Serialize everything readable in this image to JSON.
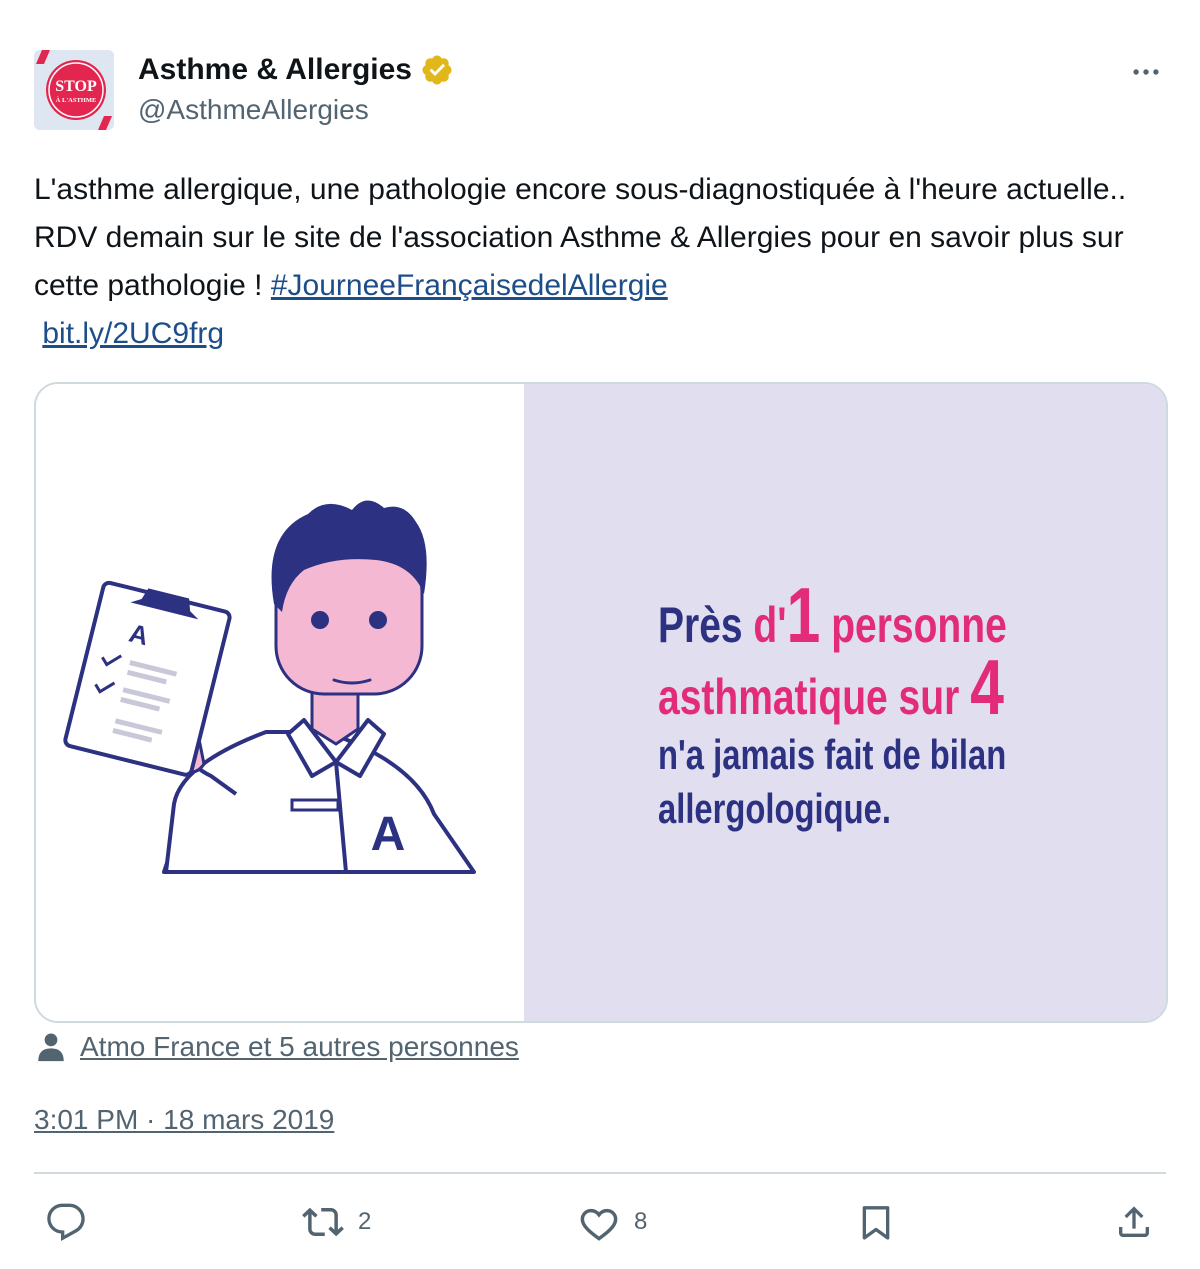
{
  "tweet": {
    "author": {
      "name": "Asthme & Allergies",
      "handle": "@AsthmeAllergies",
      "avatar_text_top": "STOP",
      "avatar_text_bottom": "À L'ASTHME",
      "verified_icon": "verified-badge-icon",
      "verified_color": "#e2b719"
    },
    "more_icon": "more-horizontal-icon",
    "text": {
      "body": "L'asthme allergique, une pathologie encore sous-diagnostiquée à l'heure actuelle.. RDV demain sur le site de l'association Asthme &  Allergies pour en savoir plus sur cette pathologie ! ",
      "hashtag": "#JourneeFrançaisedelAllergie",
      "link": "bit.ly/2UC9frg"
    },
    "media": {
      "illustration": "doctor-with-clipboard-illustration",
      "clipboard_letter": "A",
      "coat_letter": "A",
      "stat": {
        "w1": "Près",
        "w2": "d'",
        "num1": "1",
        "w3": "personne",
        "w4": "asthmatique sur",
        "num2": "4",
        "line3": "n'a jamais fait de bilan",
        "line4": "allergologique."
      },
      "colors": {
        "navy": "#2d3182",
        "pink": "#e22c79",
        "panel_bg": "#e1def0"
      }
    },
    "likers": {
      "icon": "person-icon",
      "text": "Atmo France et 5 autres personnes"
    },
    "timestamp": "3:01 PM · 18 mars 2019",
    "actions": {
      "reply": {
        "icon": "reply-icon",
        "count": ""
      },
      "retweet": {
        "icon": "retweet-icon",
        "count": "2"
      },
      "like": {
        "icon": "like-heart-icon",
        "count": "8"
      },
      "bookmark": {
        "icon": "bookmark-icon",
        "count": ""
      },
      "share": {
        "icon": "share-icon",
        "count": ""
      }
    },
    "link_color": "#1d4e89",
    "muted_color": "#536471"
  }
}
